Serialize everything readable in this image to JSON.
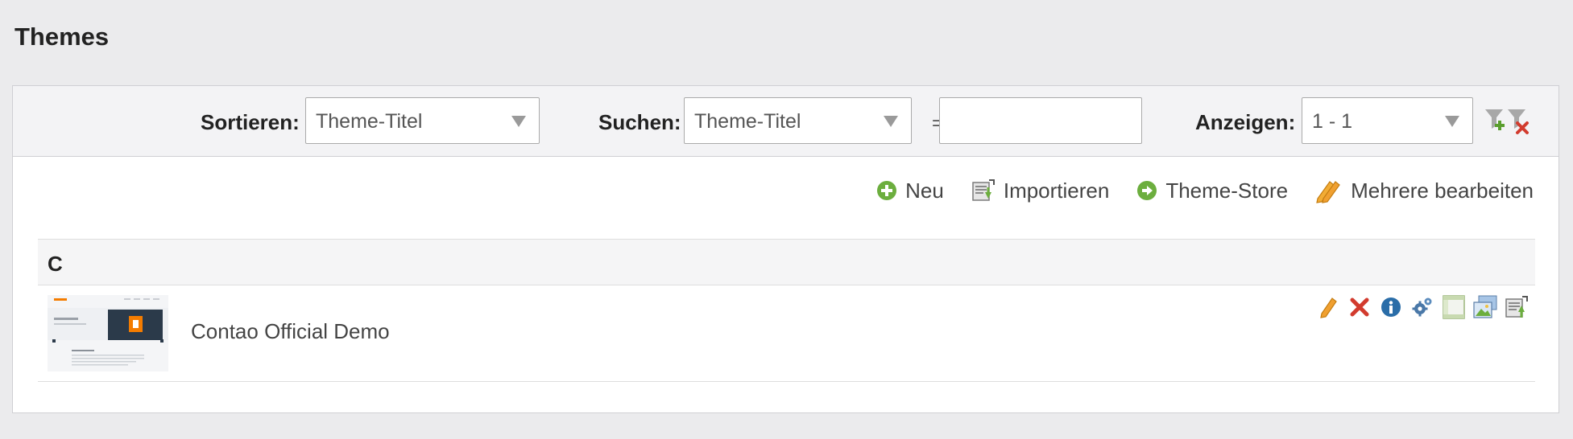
{
  "page": {
    "title": "Themes"
  },
  "filters": {
    "sort_label": "Sortieren:",
    "sort_value": "Theme-Titel",
    "search_label": "Suchen:",
    "search_field_value": "Theme-Titel",
    "search_equals": "=",
    "search_text_value": "",
    "limit_label": "Anzeigen:",
    "limit_value": "1 - 1"
  },
  "toolbar": {
    "new_label": "Neu",
    "import_label": "Importieren",
    "store_label": "Theme-Store",
    "edit_multiple_label": "Mehrere bearbeiten"
  },
  "list": {
    "group_letter": "C",
    "items": [
      {
        "title": "Contao Official Demo",
        "thumbnail_icon": "theme-preview-thumbnail",
        "operations": [
          "pencil-icon",
          "delete-icon",
          "info-icon",
          "gears-icon",
          "layout-icon",
          "image-sizes-icon",
          "export-icon"
        ]
      }
    ]
  },
  "colors": {
    "page_bg": "#ebebed",
    "panel_bg": "#ffffff",
    "filter_bar_bg": "#f3f3f5",
    "accent_green": "#6cae3e",
    "accent_orange": "#f0a030",
    "delete_red": "#d23b2e",
    "info_blue": "#2a6da8",
    "contao_orange": "#f47c00",
    "dark_navy": "#2b3a4a"
  }
}
